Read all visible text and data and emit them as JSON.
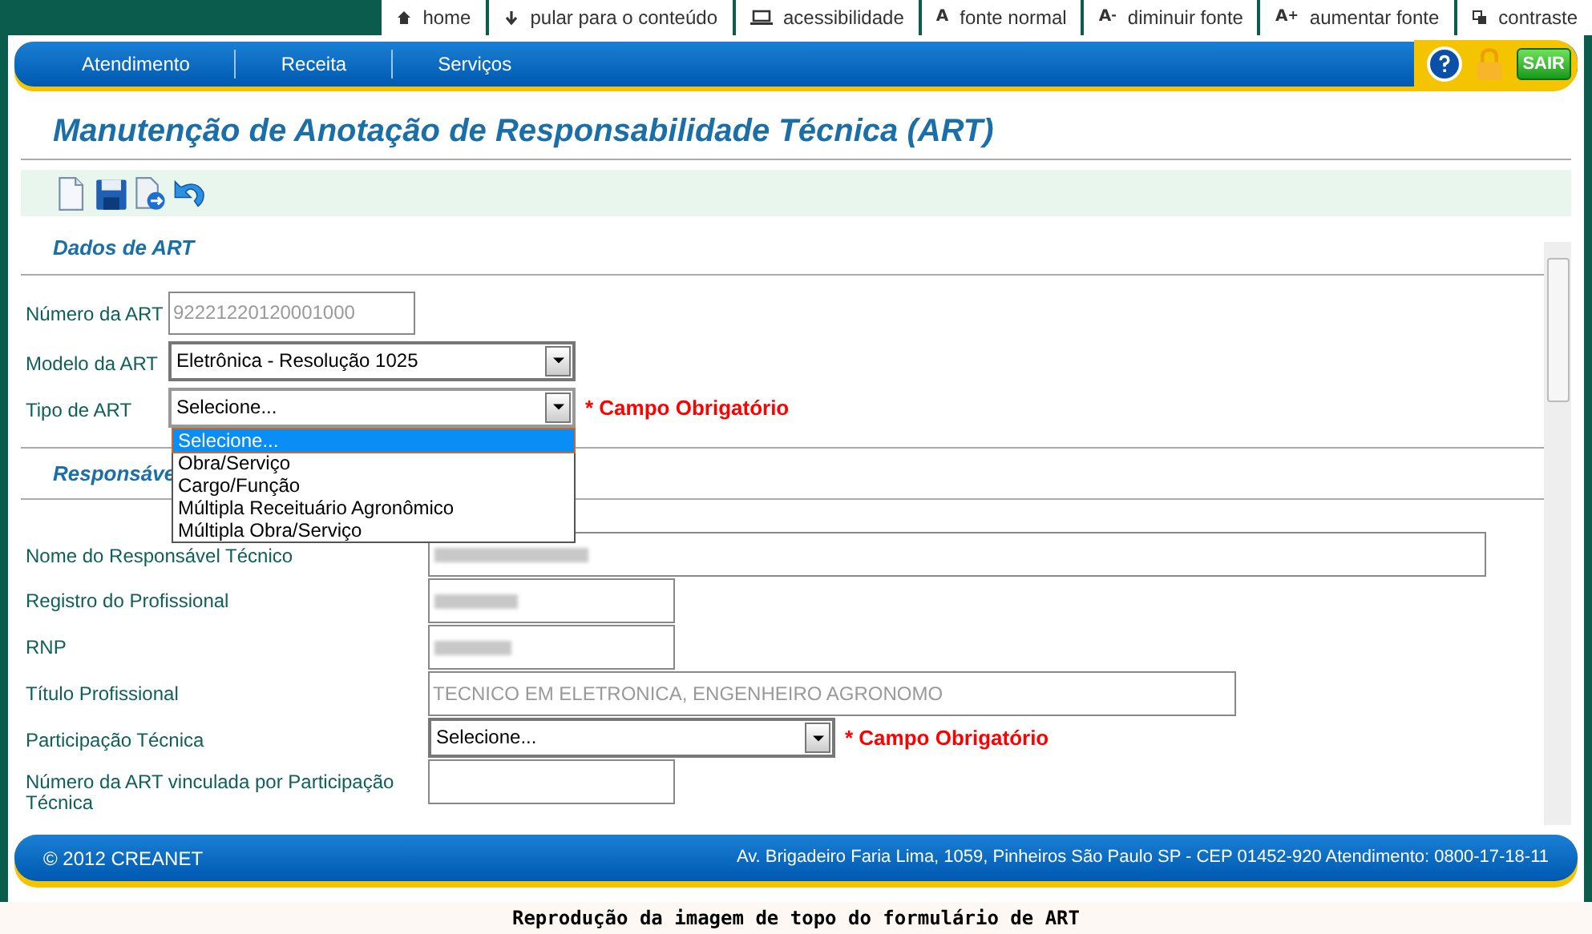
{
  "top_links": [
    {
      "kind": "home",
      "label": "home"
    },
    {
      "kind": "skip",
      "label": "pular para o conteúdo"
    },
    {
      "kind": "accessibility",
      "label": "acessibilidade"
    },
    {
      "kind": "font",
      "glyph": "A",
      "label": "fonte normal"
    },
    {
      "kind": "font",
      "glyph": "A",
      "sign": "-",
      "label": "diminuir fonte"
    },
    {
      "kind": "font",
      "glyph": "A",
      "sign": "+",
      "label": "aumentar fonte"
    },
    {
      "kind": "contrast",
      "label": "contraste"
    }
  ],
  "nav": [
    "Atendimento",
    "Receita",
    "Serviços"
  ],
  "nav_actions": [
    {
      "kind": "help"
    },
    {
      "kind": "lock"
    },
    {
      "kind": "exit",
      "label": "SAIR"
    }
  ],
  "page_title": "Manutenção de Anotação de Responsabilidade Técnica (ART)",
  "toolbar": [
    {
      "kind": "new"
    },
    {
      "kind": "save"
    },
    {
      "kind": "export"
    },
    {
      "kind": "undo"
    }
  ],
  "sections": [
    {
      "title": "Dados de ART",
      "fields": [
        {
          "label": "Número da ART",
          "kind": "input",
          "value": "92221220120001000",
          "disabled": true
        },
        {
          "label": "Modelo da ART",
          "kind": "select",
          "value": "Eletrônica - Resolução 1025"
        },
        {
          "label": "Tipo de ART",
          "kind": "select",
          "value": "Selecione...",
          "required_note": "* Campo Obrigatório",
          "expanded": true,
          "options": [
            {
              "label": "Selecione...",
              "selected": true
            },
            {
              "label": "Obra/Serviço",
              "selected": false
            },
            {
              "label": "Cargo/Função",
              "selected": false
            },
            {
              "label": "Múltipla Receituário Agronômico",
              "selected": false
            },
            {
              "label": "Múltipla Obra/Serviço",
              "selected": false
            }
          ]
        }
      ]
    },
    {
      "title": "Responsáve",
      "fields": [
        {
          "label": "Nome do Responsável Técnico",
          "kind": "input",
          "blurred": true
        },
        {
          "label": "Registro do Profissional",
          "kind": "input",
          "blurred": true
        },
        {
          "label": "RNP",
          "kind": "input",
          "blurred": true
        },
        {
          "label": "Título Profissional",
          "kind": "input",
          "value": "TECNICO EM ELETRONICA, ENGENHEIRO AGRONOMO",
          "disabled": true
        },
        {
          "label": "Participação Técnica",
          "kind": "select",
          "value": "Selecione...",
          "required_note": "* Campo Obrigatório"
        },
        {
          "label": "Número da ART vinculada por Participação Técnica",
          "kind": "input"
        }
      ]
    }
  ],
  "footer": {
    "copyright": "© 2012 CREANET",
    "address": "Av. Brigadeiro Faria Lima, 1059, Pinheiros São Paulo SP - CEP 01452-920 Atendimento: 0800-17-18-11"
  },
  "caption": "Reprodução da imagem de topo do formulário de ART"
}
